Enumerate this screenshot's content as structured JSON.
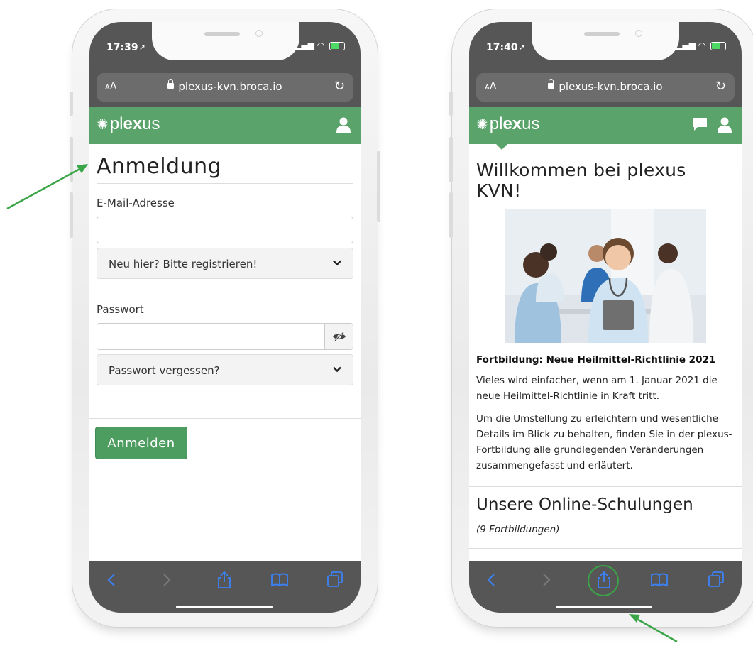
{
  "left_phone": {
    "time": "17:39",
    "url_aa": "AA",
    "url": "plexus-kvn.broca.io",
    "logo_pre": "pl",
    "logo_bold": "ex",
    "logo_post": "us",
    "title": "Anmeldung",
    "email_label": "E-Mail-Adresse",
    "register_label": "Neu hier? Bitte registrieren!",
    "password_label": "Passwort",
    "forgot_label": "Passwort vergessen?",
    "login_button": "Anmelden"
  },
  "right_phone": {
    "time": "17:40",
    "url_aa": "AA",
    "url": "plexus-kvn.broca.io",
    "logo_pre": "pl",
    "logo_bold": "ex",
    "logo_post": "us",
    "welcome_title": "Willkommen bei plexus KVN!",
    "news_title": "Fortbildung: Neue Heilmittel-Richtlinie 2021",
    "news_p1": "Vieles wird einfacher, wenn am 1. Januar 2021 die neue Heilmittel-Richtlinie in Kraft tritt.",
    "news_p2": "Um die Umstellung zu erleichtern und wesentliche Details im Blick zu behalten, finden Sie in der plexus-Fortbildung alle grundlegenden Veränderungen zusammengefasst und erläutert.",
    "courses_title": "Unsere Online-Schulungen",
    "courses_count": "(9 Fortbildungen)"
  },
  "colors": {
    "brand_green": "#5aa36a",
    "button_green": "#4e9d60",
    "arrow_green": "#3aa547",
    "ios_blue": "#3b82f6"
  },
  "icons": [
    "user-icon",
    "chat-icon",
    "chevron-down-icon",
    "eye-slash-icon",
    "back-icon",
    "forward-icon",
    "share-icon",
    "bookmarks-icon",
    "tabs-icon",
    "reload-icon",
    "lock-icon"
  ]
}
